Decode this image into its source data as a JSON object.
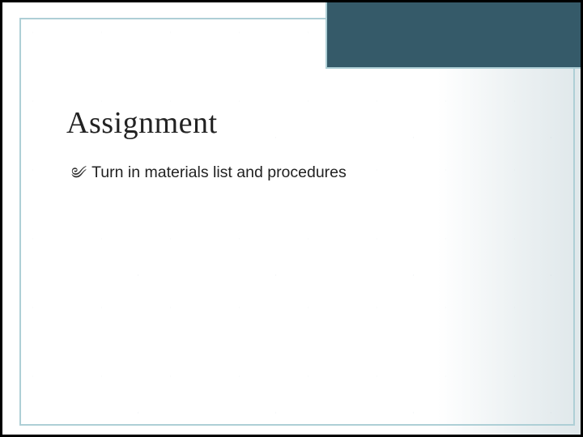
{
  "slide": {
    "title": "Assignment",
    "bullets": [
      {
        "icon": "flourish",
        "text": "Turn in materials list and procedures"
      }
    ]
  },
  "colors": {
    "accent": "#aecfd6",
    "corner_block": "#355a69",
    "outer_frame": "#000000"
  }
}
